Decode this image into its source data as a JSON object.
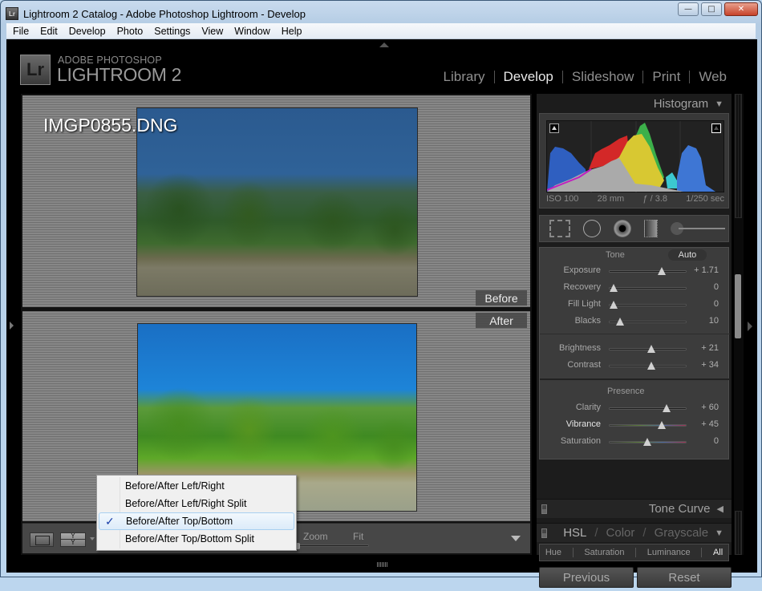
{
  "window": {
    "title": "Lightroom 2 Catalog - Adobe Photoshop Lightroom - Develop",
    "app_icon": "Lr",
    "controls": {
      "minimize": "—",
      "maximize": "□",
      "close": "✕"
    }
  },
  "menubar": [
    "File",
    "Edit",
    "Develop",
    "Photo",
    "Settings",
    "View",
    "Window",
    "Help"
  ],
  "identity_plate": {
    "logo": "Lr",
    "line1": "ADOBE PHOTOSHOP",
    "line2": "LIGHTROOM 2"
  },
  "modules": [
    {
      "label": "Library",
      "active": false
    },
    {
      "label": "Develop",
      "active": true
    },
    {
      "label": "Slideshow",
      "active": false
    },
    {
      "label": "Print",
      "active": false
    },
    {
      "label": "Web",
      "active": false
    }
  ],
  "viewer": {
    "filename": "IMGP0855.DNG",
    "before_label": "Before",
    "after_label": "After"
  },
  "toolbar": {
    "zoom_label": "Zoom",
    "fit_label": "Fit",
    "ba_icon_text": "Y"
  },
  "view_menu": {
    "items": [
      {
        "label": "Before/After Left/Right",
        "checked": false
      },
      {
        "label": "Before/After Left/Right Split",
        "checked": false
      },
      {
        "label": "Before/After Top/Bottom",
        "checked": true
      },
      {
        "label": "Before/After Top/Bottom Split",
        "checked": false
      }
    ],
    "check_glyph": "✓"
  },
  "histogram": {
    "title": "Histogram",
    "iso": "ISO 100",
    "focal": "28 mm",
    "aperture": "ƒ / 3.8",
    "shutter": "1/250 sec"
  },
  "basic": {
    "tone_label": "Tone",
    "auto_label": "Auto",
    "presence_label": "Presence",
    "tone": [
      {
        "label": "Exposure",
        "value": "+ 1.71",
        "pos": 0.68
      },
      {
        "label": "Recovery",
        "value": "0",
        "pos": 0.05
      },
      {
        "label": "Fill Light",
        "value": "0",
        "pos": 0.05
      },
      {
        "label": "Blacks",
        "value": "10",
        "pos": 0.14
      }
    ],
    "tone2": [
      {
        "label": "Brightness",
        "value": "+ 21",
        "pos": 0.55
      },
      {
        "label": "Contrast",
        "value": "+ 34",
        "pos": 0.55
      }
    ],
    "presence": [
      {
        "label": "Clarity",
        "value": "+ 60",
        "pos": 0.75,
        "highlight": false
      },
      {
        "label": "Vibrance",
        "value": "+ 45",
        "pos": 0.68,
        "highlight": true
      },
      {
        "label": "Saturation",
        "value": "0",
        "pos": 0.49,
        "highlight": false
      }
    ]
  },
  "panels": {
    "tone_curve": "Tone Curve",
    "hsl": "HSL",
    "color": "Color",
    "grayscale": "Grayscale",
    "slash": "/",
    "hsl_tabs": [
      {
        "label": "Hue",
        "active": false
      },
      {
        "label": "Saturation",
        "active": false
      },
      {
        "label": "Luminance",
        "active": false
      },
      {
        "label": "All",
        "active": true
      }
    ]
  },
  "buttons": {
    "previous": "Previous",
    "reset": "Reset"
  }
}
